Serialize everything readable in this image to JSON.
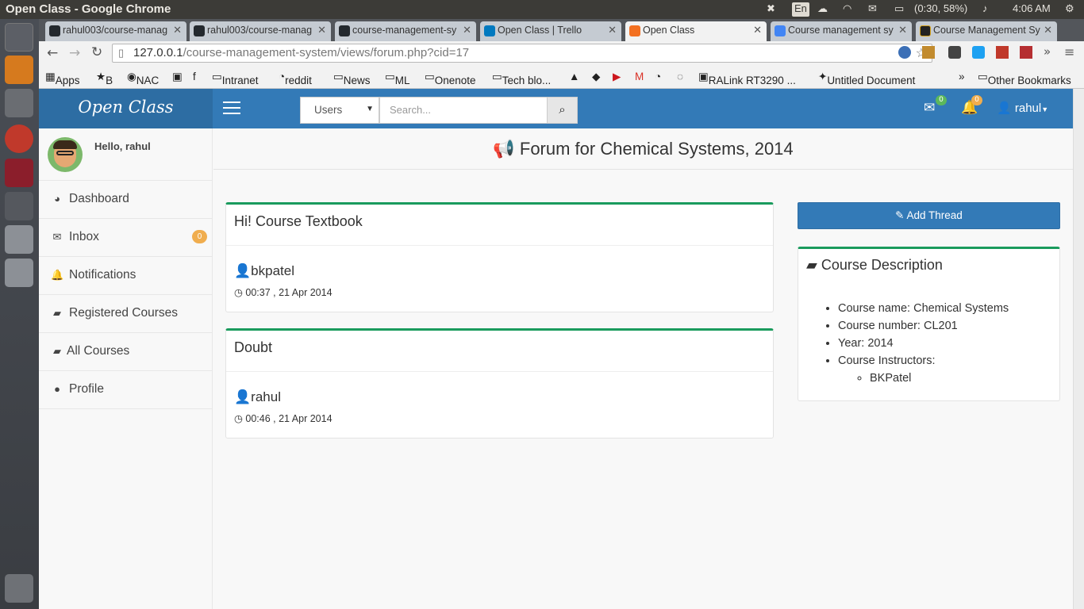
{
  "system": {
    "window_title": "Open Class - Google Chrome",
    "keyboard": "En",
    "battery": "(0:30, 58%)",
    "time": "4:06 AM"
  },
  "browser": {
    "tabs": [
      {
        "label": "rahul003/course-manag",
        "color": "#24292e"
      },
      {
        "label": "rahul003/course-manag",
        "color": "#24292e"
      },
      {
        "label": "course-management-sy",
        "color": "#24292e"
      },
      {
        "label": "Open Class | Trello",
        "color": "#0079bf"
      },
      {
        "label": "Open Class",
        "color": "#f37021"
      },
      {
        "label": "Course management sy",
        "color": "#4285f4"
      },
      {
        "label": "Course Management Sy",
        "color": "#222222"
      }
    ],
    "url_host": "127.0.0.1",
    "url_path": "/course-management-system/views/forum.php?cid=17",
    "bookmarks": [
      "Apps",
      "B",
      "NAC",
      "Intranet",
      "reddit",
      "News",
      "ML",
      "Onenote",
      "Tech blo...",
      "RALink RT3290 ...",
      "Untitled Document",
      "Other Bookmarks"
    ]
  },
  "app": {
    "brand": "Open Class",
    "search_scope": "Users",
    "search_placeholder": "Search...",
    "messages_count": "0",
    "notifications_count": "0",
    "user_name": "rahul",
    "greeting": "Hello, rahul",
    "sidebar": [
      {
        "label": "Dashboard",
        "icon": "dashboard-icon"
      },
      {
        "label": "Inbox",
        "icon": "envelope-icon",
        "badge": "0"
      },
      {
        "label": "Notifications",
        "icon": "bell-icon"
      },
      {
        "label": "Registered Courses",
        "icon": "book-icon"
      },
      {
        "label": "All Courses",
        "icon": "book-icon"
      },
      {
        "label": "Profile",
        "icon": "user-icon"
      }
    ],
    "page_title": "Forum for Chemical Systems, 2014",
    "threads": [
      {
        "title": "Hi! Course Textbook",
        "author": "bkpatel",
        "time": "00:37 , 21 Apr 2014"
      },
      {
        "title": "Doubt",
        "author": "rahul",
        "time": "00:46 , 21 Apr 2014"
      }
    ],
    "add_thread_label": "Add Thread",
    "course_description": {
      "heading": "Course Description",
      "name": "Course name: Chemical Systems",
      "number": "Course number: CL201",
      "year": "Year: 2014",
      "instructors_label": "Course Instructors:",
      "instructors": [
        "BKPatel"
      ]
    },
    "colors": {
      "primary": "#337ab7",
      "accent_green": "#1a9b5d",
      "badge_orange": "#f0ad4e",
      "badge_green": "#5cb85c"
    }
  }
}
